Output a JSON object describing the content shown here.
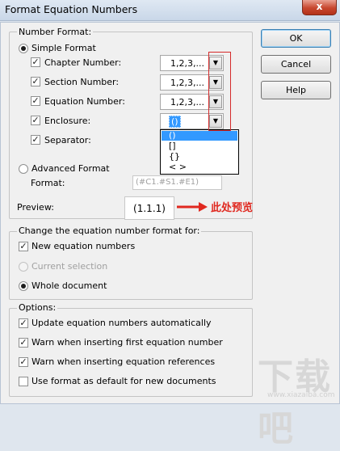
{
  "window": {
    "title": "Format Equation Numbers",
    "close_glyph": "x"
  },
  "buttons": {
    "ok": "OK",
    "cancel": "Cancel",
    "help": "Help"
  },
  "number_format": {
    "legend": "Number Format:",
    "simple_format": "Simple Format",
    "chapter_number": {
      "label": "Chapter Number:",
      "value": "1,2,3,..."
    },
    "section_number": {
      "label": "Section Number:",
      "value": "1,2,3,..."
    },
    "equation_number": {
      "label": "Equation Number:",
      "value": "1,2,3,..."
    },
    "enclosure": {
      "label": "Enclosure:",
      "value": "()",
      "options": [
        "()",
        "[]",
        "{}",
        "< >"
      ]
    },
    "separator": {
      "label": "Separator:"
    },
    "advanced_format": "Advanced Format",
    "format_label": "Format:",
    "format_value": "(#C1.#S1.#E1)",
    "preview_label": "Preview:",
    "preview_value": "(1.1.1)"
  },
  "annotation": {
    "text": "此处预览",
    "color": "#e0281f"
  },
  "change_for": {
    "legend": "Change the equation number format for:",
    "new_equation_numbers": "New equation numbers",
    "current_selection": "Current selection",
    "whole_document": "Whole document"
  },
  "options": {
    "legend": "Options:",
    "items": [
      {
        "label": "Update equation numbers automatically",
        "checked": true
      },
      {
        "label": "Warn when inserting first equation number",
        "checked": true
      },
      {
        "label": "Warn when inserting equation references",
        "checked": true
      },
      {
        "label": "Use format as default for new documents",
        "checked": false
      }
    ]
  },
  "watermark": {
    "text": "下载吧",
    "url": "www.xiazaiba.com"
  },
  "glyphs": {
    "check": "✓",
    "arrow_down": "▼"
  },
  "icons": [
    "close-icon",
    "chevron-down-icon",
    "arrow-right-icon"
  ]
}
